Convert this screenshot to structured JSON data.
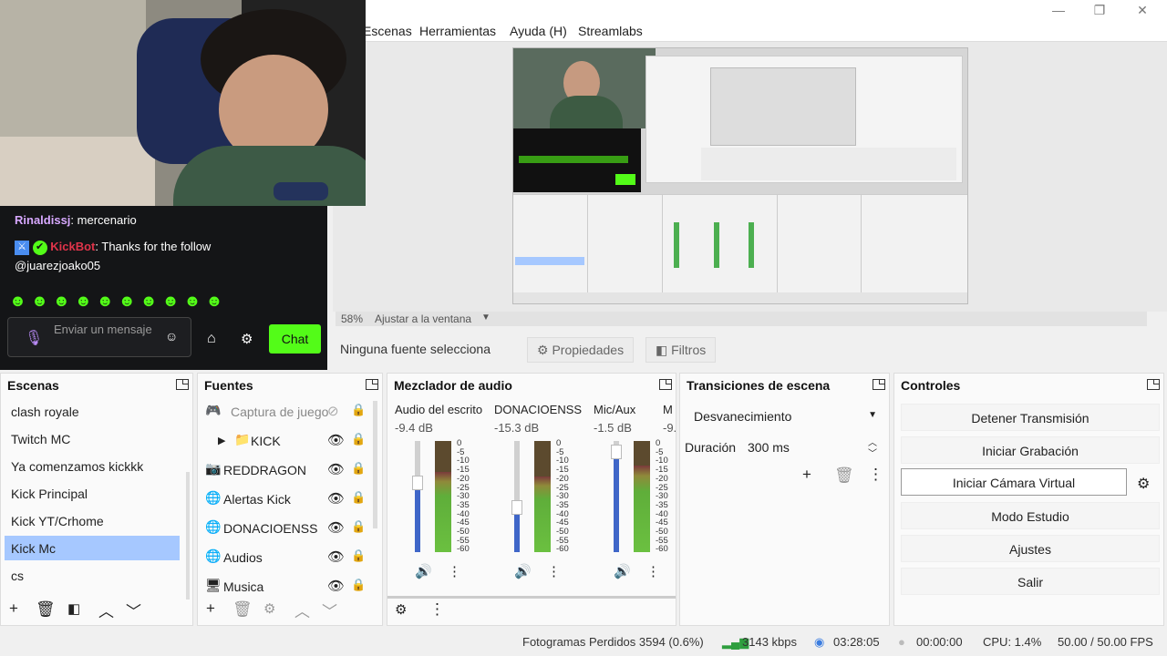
{
  "window": {
    "minimize": "—",
    "maximize": "❐",
    "close": "✕"
  },
  "menu": [
    "Escenas",
    "Herramientas",
    "Ayuda (H)",
    "Streamlabs"
  ],
  "zoom": {
    "level": "58%",
    "fit": "Ajustar a la ventana"
  },
  "sourcebar": {
    "status": "Ninguna fuente selecciona",
    "properties": "Propiedades",
    "filters": "Filtros"
  },
  "chat": {
    "msg1_user": "Rinaldissj",
    "msg1_text": "mercenario",
    "msg2_user": "KickBot",
    "msg2_text": "Thanks for the follow",
    "msg2_line2": "@juarezjoako05",
    "placeholder": "Enviar un mensaje",
    "chat_button": "Chat"
  },
  "scenes": {
    "title": "Escenas",
    "items": [
      "clash royale",
      "Twitch MC",
      "Ya comenzamos kickkk",
      "Kick Principal",
      "Kick YT/Crhome",
      "Kick Mc",
      "cs"
    ],
    "selected": 5
  },
  "sources": {
    "title": "Fuentes",
    "items": [
      {
        "icon": "🎮",
        "name": "Captura de juego"
      },
      {
        "icon": "📁",
        "name": "KICK"
      },
      {
        "icon": "📷",
        "name": "REDDRAGON"
      },
      {
        "icon": "🌐",
        "name": "Alertas Kick"
      },
      {
        "icon": "🌐",
        "name": "DONACIOENSS"
      },
      {
        "icon": "🌐",
        "name": "Audios"
      },
      {
        "icon": "🖥",
        "name": "Musica"
      }
    ]
  },
  "mixer": {
    "title": "Mezclador de audio",
    "channels": [
      {
        "name": "Audio del escrito",
        "db": "-9.4 dB",
        "level": 0.62
      },
      {
        "name": "DONACIOENSS",
        "db": "-15.3 dB",
        "level": 0.4
      },
      {
        "name": "Mic/Aux",
        "db": "-1.5 dB",
        "level": 0.9
      },
      {
        "name": "M",
        "db": "-9.",
        "level": 0.55
      }
    ],
    "scale": [
      "0",
      "-5",
      "-10",
      "-15",
      "-20",
      "-25",
      "-30",
      "-35",
      "-40",
      "-45",
      "-50",
      "-55",
      "-60"
    ]
  },
  "transitions": {
    "title": "Transiciones de escena",
    "type": "Desvanecimiento",
    "duration_label": "Duración",
    "duration": "300 ms"
  },
  "controls": {
    "title": "Controles",
    "stop_stream": "Detener Transmisión",
    "start_recording": "Iniciar Grabación",
    "virtual_cam": "Iniciar Cámara Virtual",
    "studio_mode": "Modo Estudio",
    "settings": "Ajustes",
    "exit": "Salir"
  },
  "status": {
    "dropped": "Fotogramas Perdidos 3594 (0.6%)",
    "bitrate": "3143 kbps",
    "live_time": "03:28:05",
    "rec_time": "00:00:00",
    "cpu": "CPU: 1.4%",
    "fps": "50.00 / 50.00 FPS"
  },
  "colors": {
    "accent": "#53fc18",
    "selection": "#a6c8ff",
    "kickbot": "#e0344a",
    "user1": "#d7a8ff"
  }
}
